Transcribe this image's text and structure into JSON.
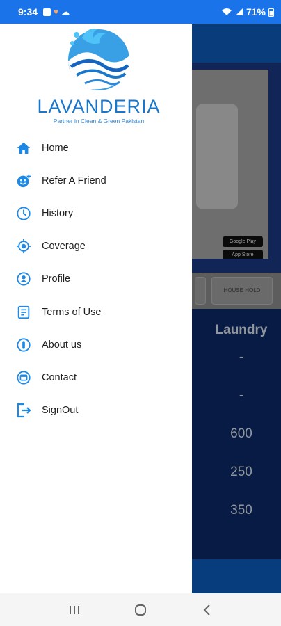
{
  "status": {
    "time": "9:34",
    "battery": "71%"
  },
  "brand": {
    "name": "LAVANDERIA",
    "tagline": "Partner in Clean & Green Pakistan"
  },
  "menu": {
    "items": [
      {
        "label": "Home",
        "icon": "home-icon"
      },
      {
        "label": "Refer A Friend",
        "icon": "refer-friend-icon"
      },
      {
        "label": "History",
        "icon": "history-clock-icon"
      },
      {
        "label": "Coverage",
        "icon": "coverage-target-icon"
      },
      {
        "label": "Profile",
        "icon": "profile-icon"
      },
      {
        "label": "Terms of Use",
        "icon": "terms-document-icon"
      },
      {
        "label": "About us",
        "icon": "about-info-icon"
      },
      {
        "label": "Contact",
        "icon": "contact-icon"
      },
      {
        "label": "SignOut",
        "icon": "signout-icon"
      }
    ]
  },
  "background": {
    "tab_household": "HOUSE HOLD",
    "column_header": "Laundry",
    "values": [
      "-",
      "-",
      "600",
      "250",
      "350"
    ],
    "store_badges": [
      "Google Play",
      "App Store"
    ]
  },
  "colors": {
    "accent": "#1a73e8",
    "drawer_icon": "#1e88e5",
    "brand_text": "#1976c8"
  }
}
